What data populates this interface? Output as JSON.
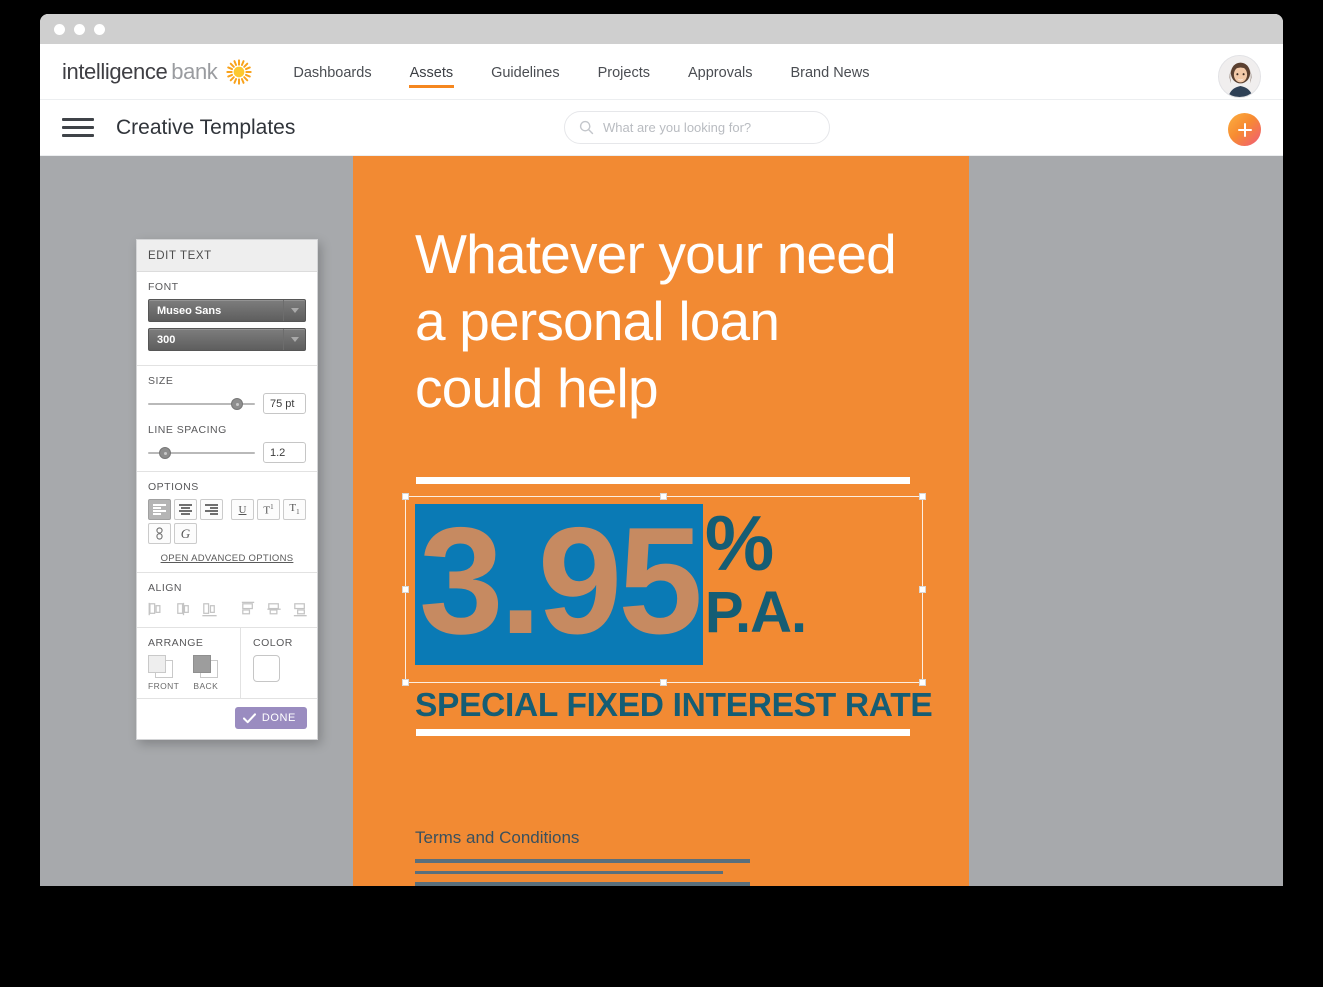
{
  "window": {
    "dots": [
      "close",
      "minimize",
      "maximize"
    ]
  },
  "topnav": {
    "logo_first": "intelligence",
    "logo_second": "bank",
    "logo_icon": "sun-icon",
    "items": [
      {
        "label": "Dashboards",
        "active": false
      },
      {
        "label": "Assets",
        "active": true
      },
      {
        "label": "Guidelines",
        "active": false
      },
      {
        "label": "Projects",
        "active": false
      },
      {
        "label": "Approvals",
        "active": false
      },
      {
        "label": "Brand News",
        "active": false
      }
    ],
    "accent_color": "#f5871f",
    "avatar_alt": "user-avatar"
  },
  "subbar": {
    "menu_icon": "hamburger-icon",
    "title": "Creative Templates",
    "search": {
      "icon": "search-icon",
      "placeholder": "What are you looking for?",
      "value": ""
    },
    "add_button_label": "+"
  },
  "edit_panel": {
    "header": "EDIT TEXT",
    "font": {
      "label": "FONT",
      "family_value": "Museo Sans",
      "weight_value": "300"
    },
    "size": {
      "label": "SIZE",
      "value": "75 pt",
      "slider_percent": 82
    },
    "line_spacing": {
      "label": "LINE SPACING",
      "value": "1.2",
      "slider_percent": 14
    },
    "options": {
      "label": "OPTIONS",
      "align_buttons": [
        {
          "name": "align-left",
          "active": true
        },
        {
          "name": "align-center",
          "active": false
        },
        {
          "name": "align-right",
          "active": false
        }
      ],
      "style_buttons": [
        {
          "name": "underline",
          "glyph": "U"
        },
        {
          "name": "superscript",
          "glyph": "T"
        },
        {
          "name": "subscript",
          "glyph": "T"
        }
      ],
      "extra_buttons": [
        {
          "name": "link-icon"
        },
        {
          "name": "glyph-icon"
        }
      ],
      "advanced_link": "OPEN ADVANCED OPTIONS"
    },
    "align": {
      "label": "ALIGN",
      "horizontal": [
        "align-object-left",
        "align-object-center",
        "align-object-right"
      ],
      "vertical": [
        "align-object-top",
        "align-object-middle",
        "align-object-bottom"
      ]
    },
    "arrange": {
      "label": "ARRANGE",
      "front_label": "FRONT",
      "back_label": "BACK"
    },
    "color": {
      "label": "COLOR",
      "swatch_hex": "#ffffff"
    },
    "done_label": "DONE",
    "done_color": "#9a8cc0"
  },
  "canvas": {
    "background_hex": "#f28a33",
    "headline": "Whatever your need a personal loan could help",
    "rate_number": "3.95",
    "rate_number_highlight_hex": "#0a7ab5",
    "rate_number_text_hex": "#c68a61",
    "percent_symbol": "%",
    "per_annum": "P.A.",
    "subheadline": "SPECIAL FIXED INTEREST RATE",
    "accent_dark_hex": "#155d74",
    "terms_title": "Terms and Conditions",
    "terms_lines": [
      100,
      92,
      100
    ],
    "selection_active": true
  },
  "workspace": {
    "background_hex": "#a7a9ac"
  }
}
